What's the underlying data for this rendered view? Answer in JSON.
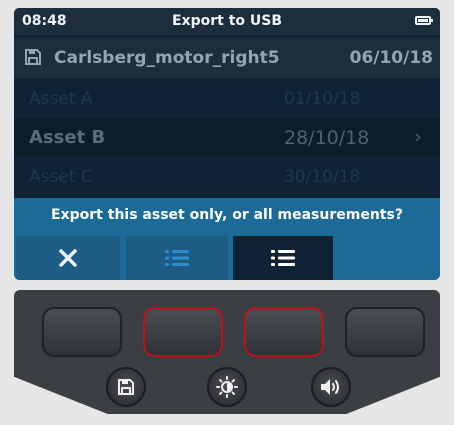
{
  "status_bar": {
    "time": "08:48",
    "title": "Export to USB"
  },
  "file": {
    "name": "Carlsberg_motor_right5",
    "date": "06/10/18"
  },
  "assets": [
    {
      "name": "Asset A",
      "date": "01/10/18",
      "selected": false
    },
    {
      "name": "Asset B",
      "date": "28/10/18",
      "selected": true,
      "chevron": "›"
    },
    {
      "name": "Asset C",
      "date": "30/10/18",
      "selected": false
    }
  ],
  "prompt": "Export this asset only, or all measurements?",
  "softkeys": [
    {
      "icon": "close-icon",
      "state": "normal"
    },
    {
      "icon": "list-icon",
      "state": "normal"
    },
    {
      "icon": "list-icon",
      "state": "selected"
    }
  ],
  "hardware_keys": [
    {
      "name": "hardkey-1",
      "highlighted": false
    },
    {
      "name": "hardkey-2",
      "highlighted": true
    },
    {
      "name": "hardkey-3",
      "highlighted": true
    },
    {
      "name": "hardkey-4",
      "highlighted": false
    }
  ],
  "round_keys": [
    {
      "icon": "save-icon"
    },
    {
      "icon": "brightness-icon"
    },
    {
      "icon": "volume-icon"
    }
  ],
  "colors": {
    "screen_bg": "#0f2334",
    "accent_blue": "#1b6a98",
    "highlight_red": "#c0121b",
    "device_body": "#3b3e42"
  }
}
